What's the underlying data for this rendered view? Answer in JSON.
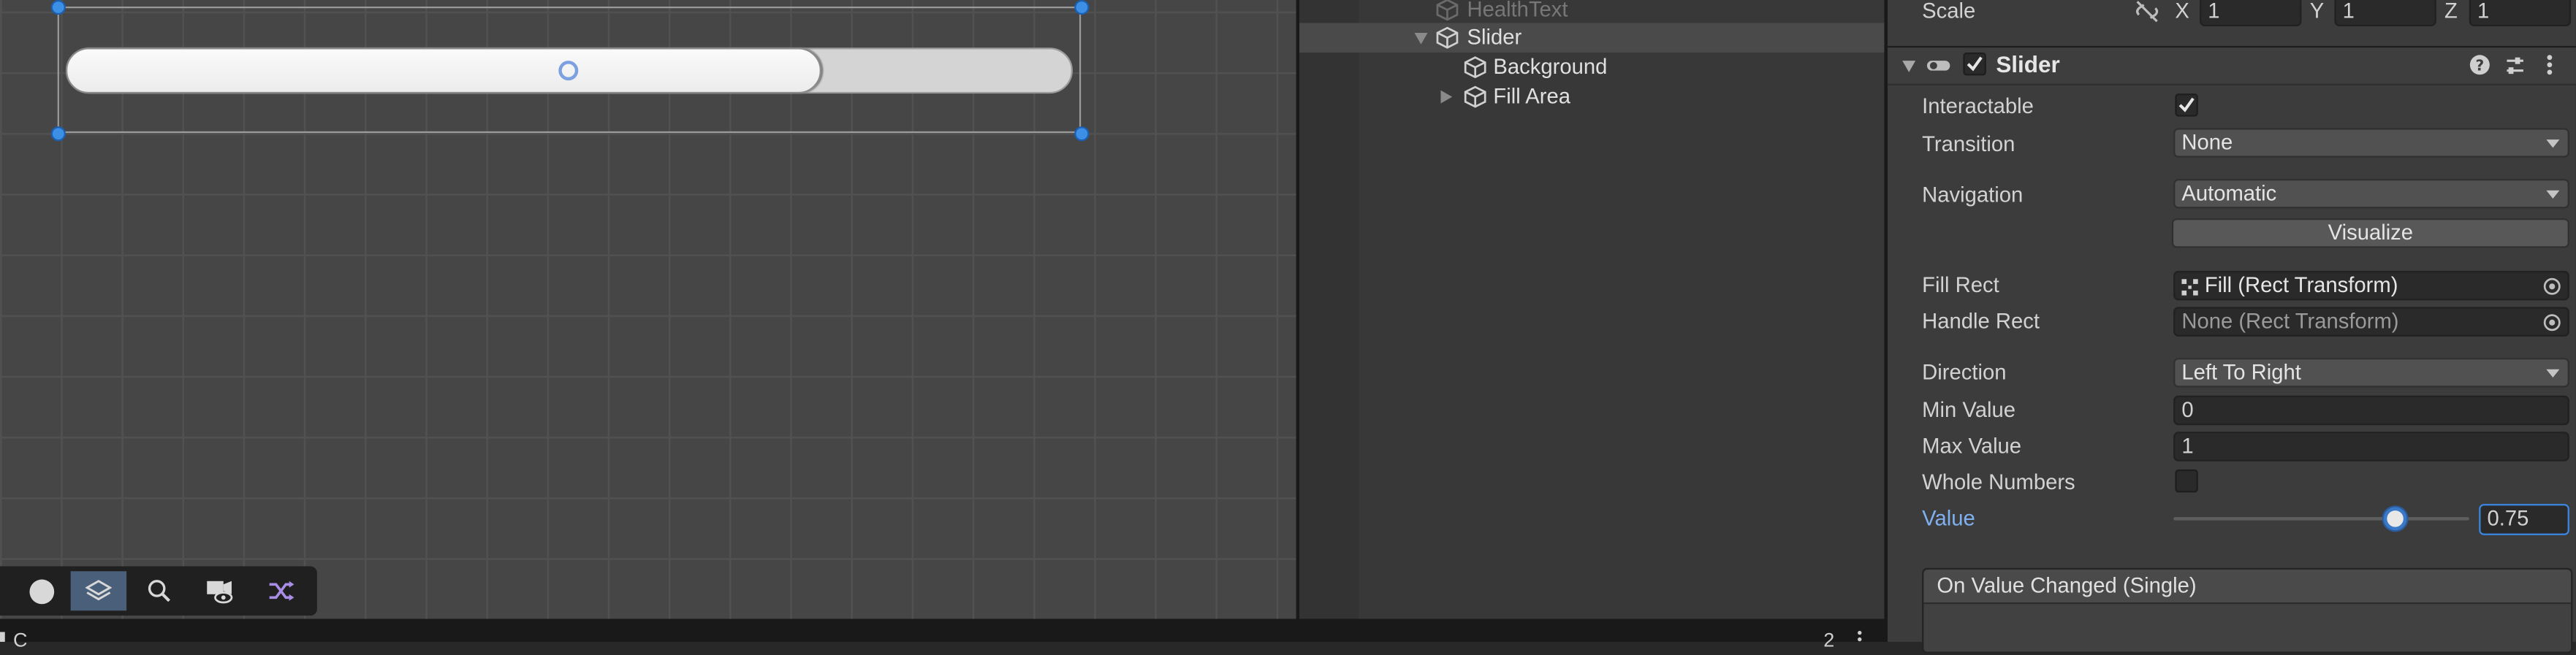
{
  "hierarchy": {
    "items": [
      {
        "label": "HealthText"
      },
      {
        "label": "Slider"
      },
      {
        "label": "Background"
      },
      {
        "label": "Fill Area"
      }
    ]
  },
  "inspector": {
    "scale": {
      "label": "Scale",
      "x_label": "X",
      "x": "1",
      "y_label": "Y",
      "y": "1",
      "z_label": "Z",
      "z": "1"
    },
    "component": {
      "title": "Slider"
    },
    "interactable": {
      "label": "Interactable",
      "checked": true
    },
    "transition": {
      "label": "Transition",
      "value": "None"
    },
    "navigation": {
      "label": "Navigation",
      "value": "Automatic"
    },
    "visualize": {
      "label": "Visualize"
    },
    "fill_rect": {
      "label": "Fill Rect",
      "value": "Fill (Rect Transform)"
    },
    "handle_rect": {
      "label": "Handle Rect",
      "value": "None (Rect Transform)"
    },
    "direction": {
      "label": "Direction",
      "value": "Left To Right"
    },
    "min_value": {
      "label": "Min Value",
      "value": "0"
    },
    "max_value": {
      "label": "Max Value",
      "value": "1"
    },
    "whole_numbers": {
      "label": "Whole Numbers",
      "checked": false
    },
    "value": {
      "label": "Value",
      "value": "0.75",
      "fraction": 0.75
    },
    "on_value_changed": {
      "label": "On Value Changed (Single)"
    }
  },
  "scene": {
    "slider_fill_fraction": 0.75
  },
  "colors": {
    "accent": "#3d8fe6",
    "value_label": "#7fb0f0",
    "highlight_row": "#4a4a4a"
  },
  "bottom_bar": {
    "left_text": "C",
    "right_text": "2"
  }
}
